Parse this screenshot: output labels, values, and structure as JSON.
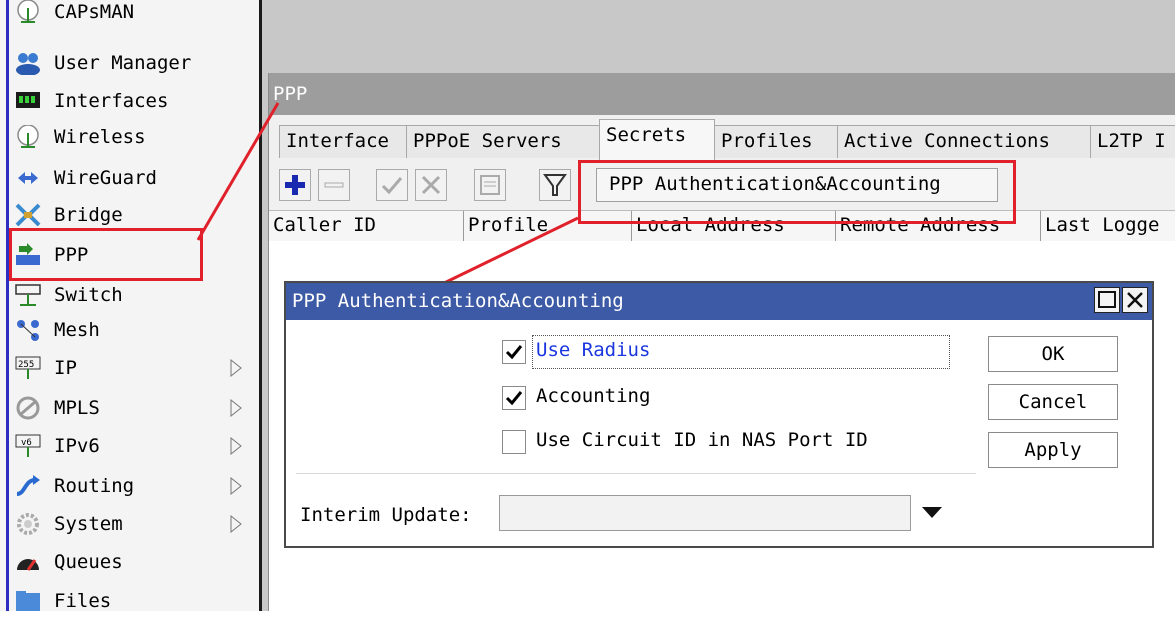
{
  "sidebar": {
    "items": [
      {
        "label": "CAPsMAN",
        "icon": "antenna-icon",
        "submenu": false
      },
      {
        "label": "User Manager",
        "icon": "users-icon",
        "submenu": false
      },
      {
        "label": "Interfaces",
        "icon": "interfaces-icon",
        "submenu": false
      },
      {
        "label": "Wireless",
        "icon": "antenna-icon",
        "submenu": false
      },
      {
        "label": "WireGuard",
        "icon": "wireguard-icon",
        "submenu": false
      },
      {
        "label": "Bridge",
        "icon": "bridge-icon",
        "submenu": false
      },
      {
        "label": "PPP",
        "icon": "ppp-icon",
        "submenu": false
      },
      {
        "label": "Switch",
        "icon": "switch-icon",
        "submenu": false
      },
      {
        "label": "Mesh",
        "icon": "mesh-icon",
        "submenu": false
      },
      {
        "label": "IP",
        "icon": "ip-icon",
        "submenu": true
      },
      {
        "label": "MPLS",
        "icon": "mpls-icon",
        "submenu": true
      },
      {
        "label": "IPv6",
        "icon": "ipv6-icon",
        "submenu": true
      },
      {
        "label": "Routing",
        "icon": "routing-icon",
        "submenu": true
      },
      {
        "label": "System",
        "icon": "gear-icon",
        "submenu": true
      },
      {
        "label": "Queues",
        "icon": "queues-icon",
        "submenu": false
      },
      {
        "label": "Files",
        "icon": "folder-icon",
        "submenu": false
      }
    ]
  },
  "ppp_window": {
    "title": "PPP",
    "tabs": [
      "Interface",
      "PPPoE Servers",
      "Secrets",
      "Profiles",
      "Active Connections",
      "L2TP I"
    ],
    "active_tab": "Secrets",
    "auth_button_label": "PPP Authentication&Accounting",
    "columns": [
      "Caller ID",
      "Profile",
      "Local Address",
      "Remote Address",
      "Last Logge"
    ]
  },
  "dialog": {
    "title": "PPP Authentication&Accounting",
    "use_radius": {
      "label": "Use Radius",
      "checked": true
    },
    "accounting": {
      "label": "Accounting",
      "checked": true
    },
    "circuit_id": {
      "label": "Use Circuit ID in NAS Port ID",
      "checked": false
    },
    "ok_label": "OK",
    "cancel_label": "Cancel",
    "apply_label": "Apply",
    "interim_label": "Interim Update:",
    "interim_value": ""
  },
  "colors": {
    "annotation_red": "#e0202a",
    "dialog_title_bg": "#3d5aa6",
    "link_blue": "#1a36e0",
    "sidebar_strip": "#2c2cc2"
  }
}
